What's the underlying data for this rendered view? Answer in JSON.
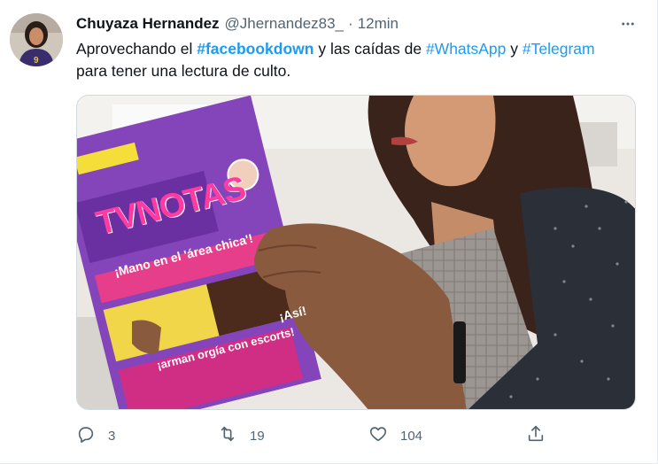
{
  "tweet": {
    "author_name": "Chuyaza Hernandez",
    "handle": "@Jhernandez83_",
    "separator": "·",
    "time": "12min",
    "more_label": "•••",
    "text": {
      "part1": "Aprovechando el ",
      "hashtag1": "#facebookdown",
      "part2": " y las caídas de ",
      "hashtag2": "#WhatsApp",
      "part3": " y ",
      "hashtag3": "#Telegram",
      "part4": "para tener una lectura de culto."
    },
    "media": {
      "magazine_title": "TVNOTAS",
      "headline1": "¡Mano en el 'área chica'!",
      "headline2": "¡arman orgía con escorts!",
      "headline3": "¡Así!"
    },
    "actions": {
      "reply_count": "3",
      "retweet_count": "19",
      "like_count": "104"
    }
  },
  "colors": {
    "accent": "#1d9bf0",
    "secondary_text": "#536471",
    "primary_text": "#0f1419"
  },
  "icons": [
    "more-icon",
    "reply-icon",
    "retweet-icon",
    "like-icon",
    "share-icon"
  ]
}
